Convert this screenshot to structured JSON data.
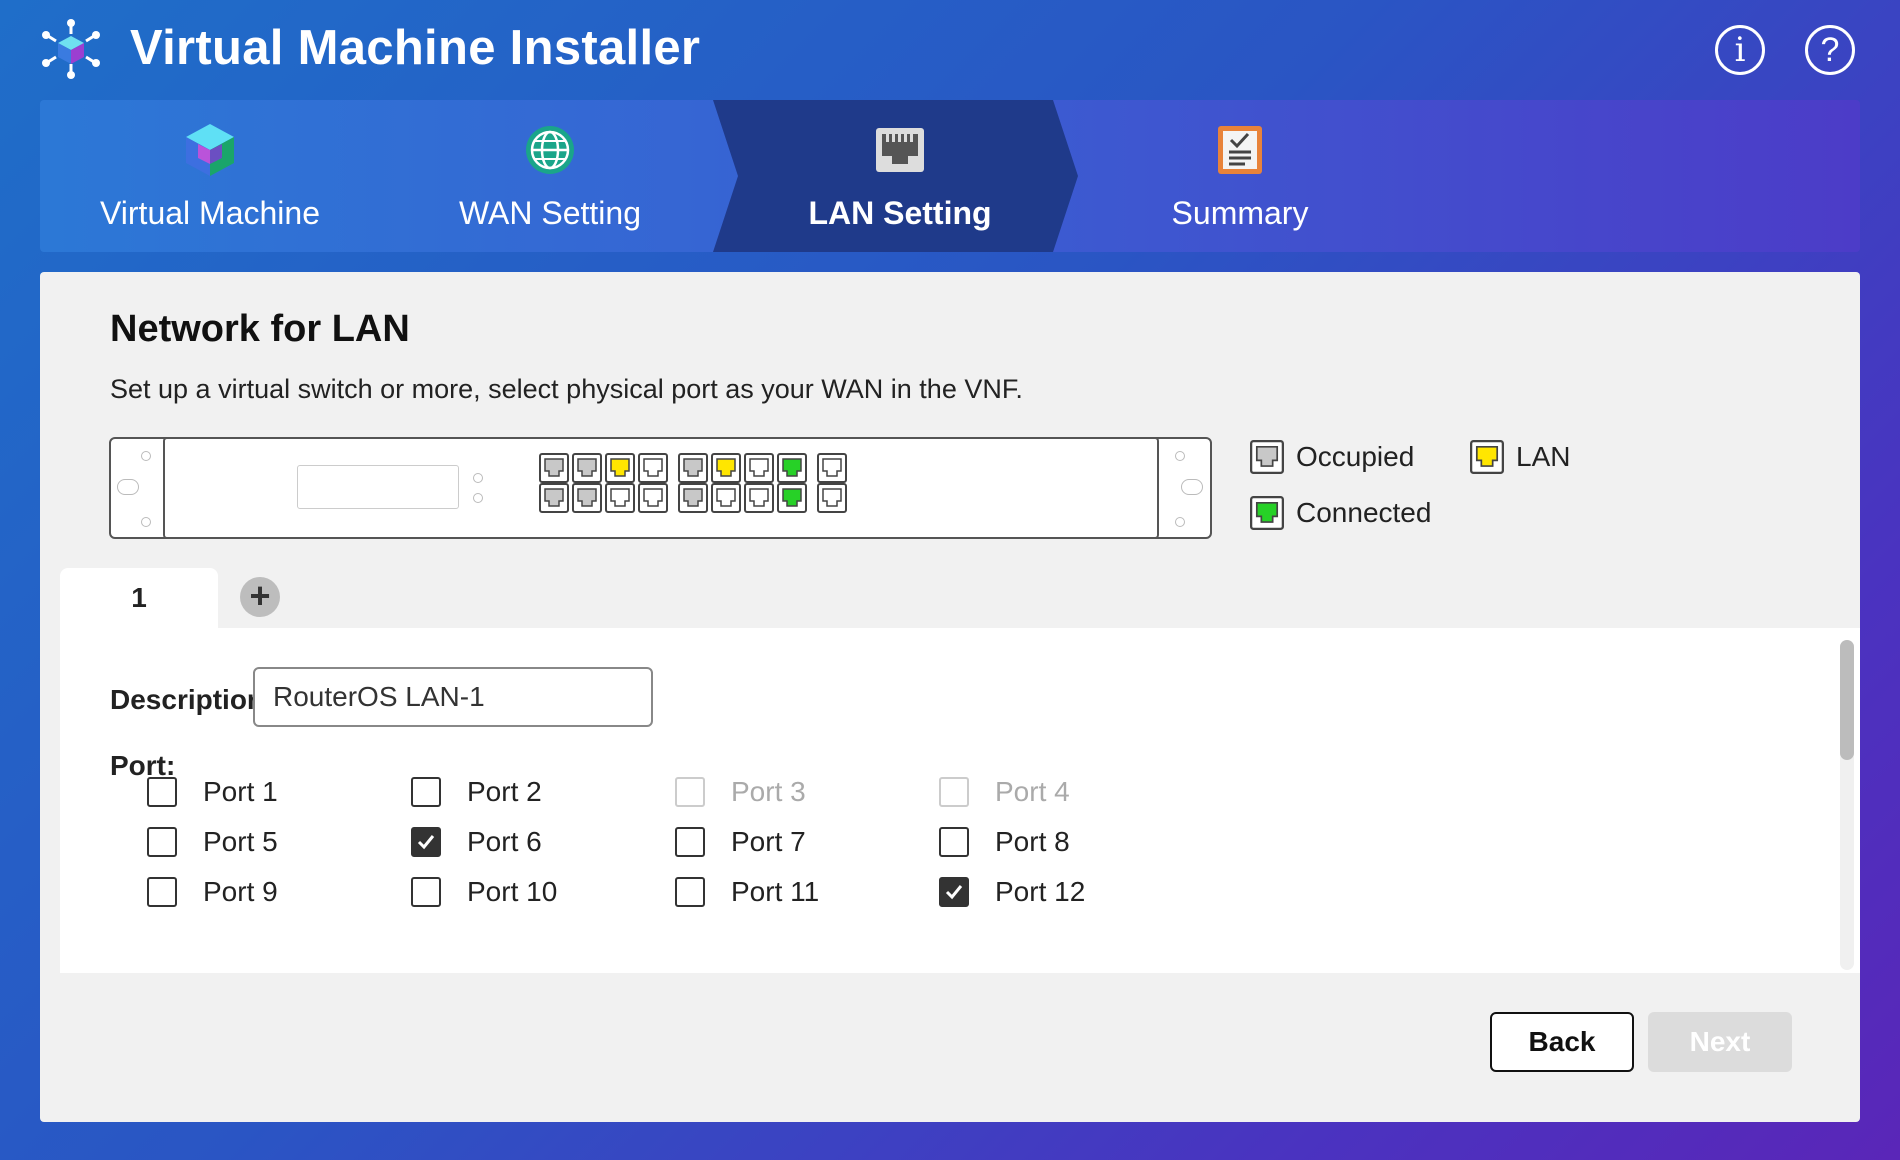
{
  "app": {
    "title": "Virtual Machine Installer"
  },
  "header": {
    "info_icon": "info-icon",
    "help_icon": "help-icon",
    "info_glyph": "i",
    "help_glyph": "?"
  },
  "steps": [
    {
      "label": "Virtual Machine",
      "icon": "cube-icon",
      "active": false
    },
    {
      "label": "WAN Setting",
      "icon": "globe-icon",
      "active": false
    },
    {
      "label": "LAN Setting",
      "icon": "ethernet-port-icon",
      "active": true
    },
    {
      "label": "Summary",
      "icon": "checklist-icon",
      "active": false
    }
  ],
  "panel": {
    "title": "Network for LAN",
    "subtitle": "Set up a virtual switch or more, select physical port as your WAN in the VNF."
  },
  "switch": {
    "ports_top": [
      "occupied",
      "occupied",
      "lan",
      "empty",
      "occupied",
      "lan",
      "empty",
      "connected",
      "empty"
    ],
    "ports_bottom": [
      "occupied",
      "occupied",
      "empty",
      "empty",
      "occupied",
      "empty",
      "empty",
      "connected",
      "empty"
    ]
  },
  "legend": {
    "occupied": "Occupied",
    "lan": "LAN",
    "connected": "Connected"
  },
  "tabs": {
    "active": "1",
    "add_glyph": "+"
  },
  "form": {
    "description_label": "Description:",
    "description_value": "RouterOS LAN-1",
    "port_label": "Port:",
    "ports": [
      {
        "label": "Port 1",
        "checked": false,
        "disabled": false
      },
      {
        "label": "Port 2",
        "checked": false,
        "disabled": false
      },
      {
        "label": "Port 3",
        "checked": false,
        "disabled": true
      },
      {
        "label": "Port 4",
        "checked": false,
        "disabled": true
      },
      {
        "label": "Port 5",
        "checked": false,
        "disabled": false
      },
      {
        "label": "Port 6",
        "checked": true,
        "disabled": false
      },
      {
        "label": "Port 7",
        "checked": false,
        "disabled": false
      },
      {
        "label": "Port 8",
        "checked": false,
        "disabled": false
      },
      {
        "label": "Port 9",
        "checked": false,
        "disabled": false
      },
      {
        "label": "Port 10",
        "checked": false,
        "disabled": false
      },
      {
        "label": "Port 11",
        "checked": false,
        "disabled": false
      },
      {
        "label": "Port 12",
        "checked": true,
        "disabled": false
      }
    ]
  },
  "buttons": {
    "back": "Back",
    "next": "Next"
  },
  "colors": {
    "occupied": "#c8c8c8",
    "lan": "#ffe600",
    "connected": "#27d127",
    "empty": "#ffffff",
    "active_step": "#1f3a8a"
  }
}
